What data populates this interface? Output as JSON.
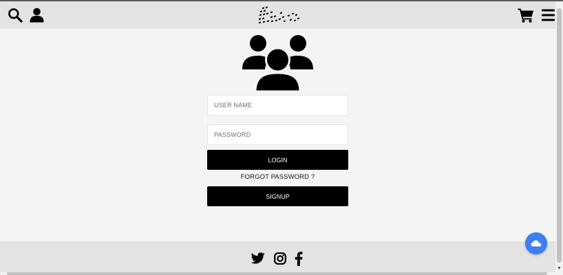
{
  "header": {
    "icons": {
      "search": "search-icon",
      "user": "user-icon",
      "logo": "brand-logo",
      "cart": "cart-icon",
      "menu": "menu-icon"
    }
  },
  "login": {
    "hero_icon": "users-group-icon",
    "username_placeholder": "USER NAME",
    "password_placeholder": "PASSWORD",
    "login_label": "LOGIN",
    "forgot_label": "FORGOT PASSWORD ?",
    "signup_label": "SIGNUP"
  },
  "footer": {
    "social": [
      "twitter-icon",
      "instagram-icon",
      "facebook-icon"
    ]
  },
  "fab": {
    "icon": "cloud-icon"
  },
  "colors": {
    "header_bg": "#e3e3e3",
    "page_bg": "#f4f4f4",
    "button_bg": "#000000",
    "button_text": "#ffffff",
    "fab_bg": "#3d7ef0"
  }
}
